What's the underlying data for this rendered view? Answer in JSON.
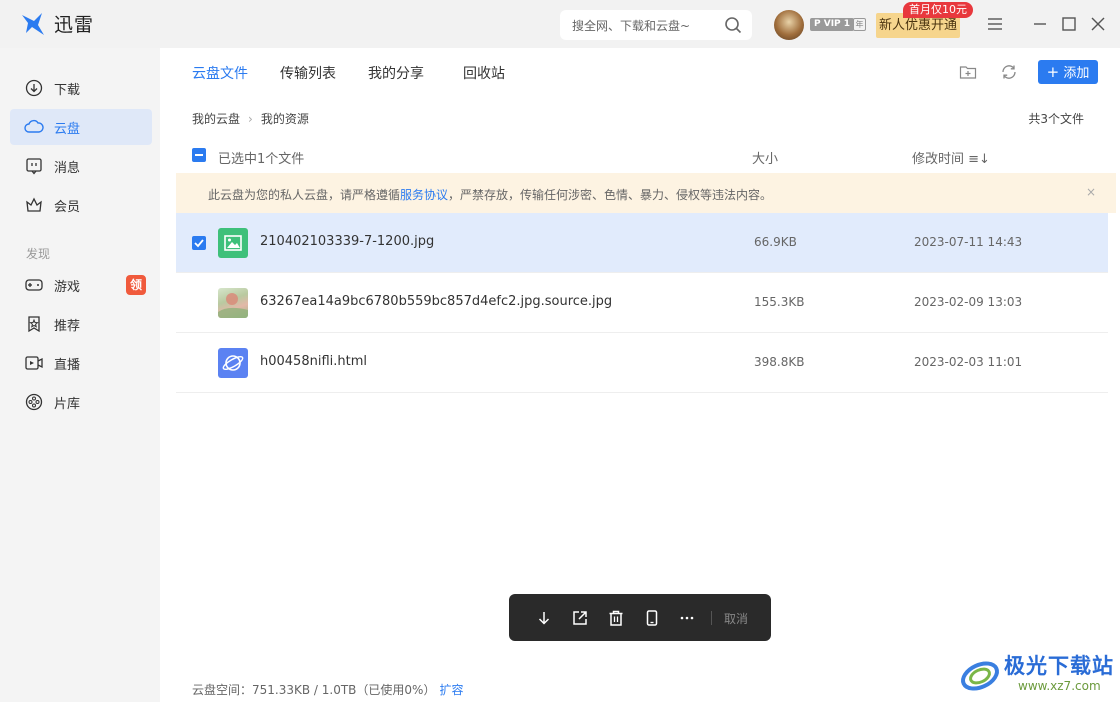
{
  "app": {
    "name": "迅雷"
  },
  "search": {
    "placeholder": "搜全网、下载和云盘~"
  },
  "account": {
    "vip_label": "P VIP 1",
    "vip_unit": "年",
    "promo_button": "新人优惠开通",
    "promo_tag": "首月仅10元"
  },
  "sidebar": {
    "items": [
      {
        "label": "下载",
        "icon": "download-icon"
      },
      {
        "label": "云盘",
        "icon": "cloud-icon",
        "active": true
      },
      {
        "label": "消息",
        "icon": "message-icon"
      },
      {
        "label": "会员",
        "icon": "member-icon"
      }
    ],
    "section_label": "发现",
    "discover": [
      {
        "label": "游戏",
        "icon": "gamepad-icon",
        "badge": "领"
      },
      {
        "label": "推荐",
        "icon": "star-icon"
      },
      {
        "label": "直播",
        "icon": "live-icon"
      },
      {
        "label": "片库",
        "icon": "film-reel-icon"
      }
    ]
  },
  "tabs": [
    "云盘文件",
    "传输列表",
    "我的分享",
    "回收站"
  ],
  "toolbar": {
    "add_label": "添加"
  },
  "breadcrumb": {
    "root": "我的云盘",
    "current": "我的资源"
  },
  "file_count": "共3个文件",
  "table": {
    "selected_text": "已选中1个文件",
    "size_header": "大小",
    "time_header": "修改时间 ≡↓"
  },
  "notice": {
    "text_before": "此云盘为您的私人云盘，请严格遵循",
    "link": "服务协议",
    "text_after": "，严禁存放，传输任何涉密、色情、暴力、侵权等违法内容。",
    "close": "×"
  },
  "files": [
    {
      "name": "210402103339-7-1200.jpg",
      "size": "66.9KB",
      "time": "2023-07-11 14:43",
      "selected": true,
      "icon": "image-file-icon"
    },
    {
      "name": "63267ea14a9bc6780b559bc857d4efc2.jpg.source.jpg",
      "size": "155.3KB",
      "time": "2023-02-09 13:03",
      "selected": false,
      "icon": "photo-thumbnail"
    },
    {
      "name": "h00458nifli.html",
      "size": "398.8KB",
      "time": "2023-02-03 11:01",
      "selected": false,
      "icon": "html-file-icon"
    }
  ],
  "actions": {
    "cancel": "取消"
  },
  "storage": {
    "text": "云盘空间：751.33KB / 1.0TB（已使用0%）",
    "link": "扩容"
  },
  "watermark": {
    "title": "极光下载站",
    "url": "www.xz7.com"
  },
  "colors": {
    "accent": "#2b7bf0",
    "selected_row": "#e1ebfc",
    "notice_bg": "#fdf3e2",
    "sidebar_bg": "#f4f4f4"
  }
}
